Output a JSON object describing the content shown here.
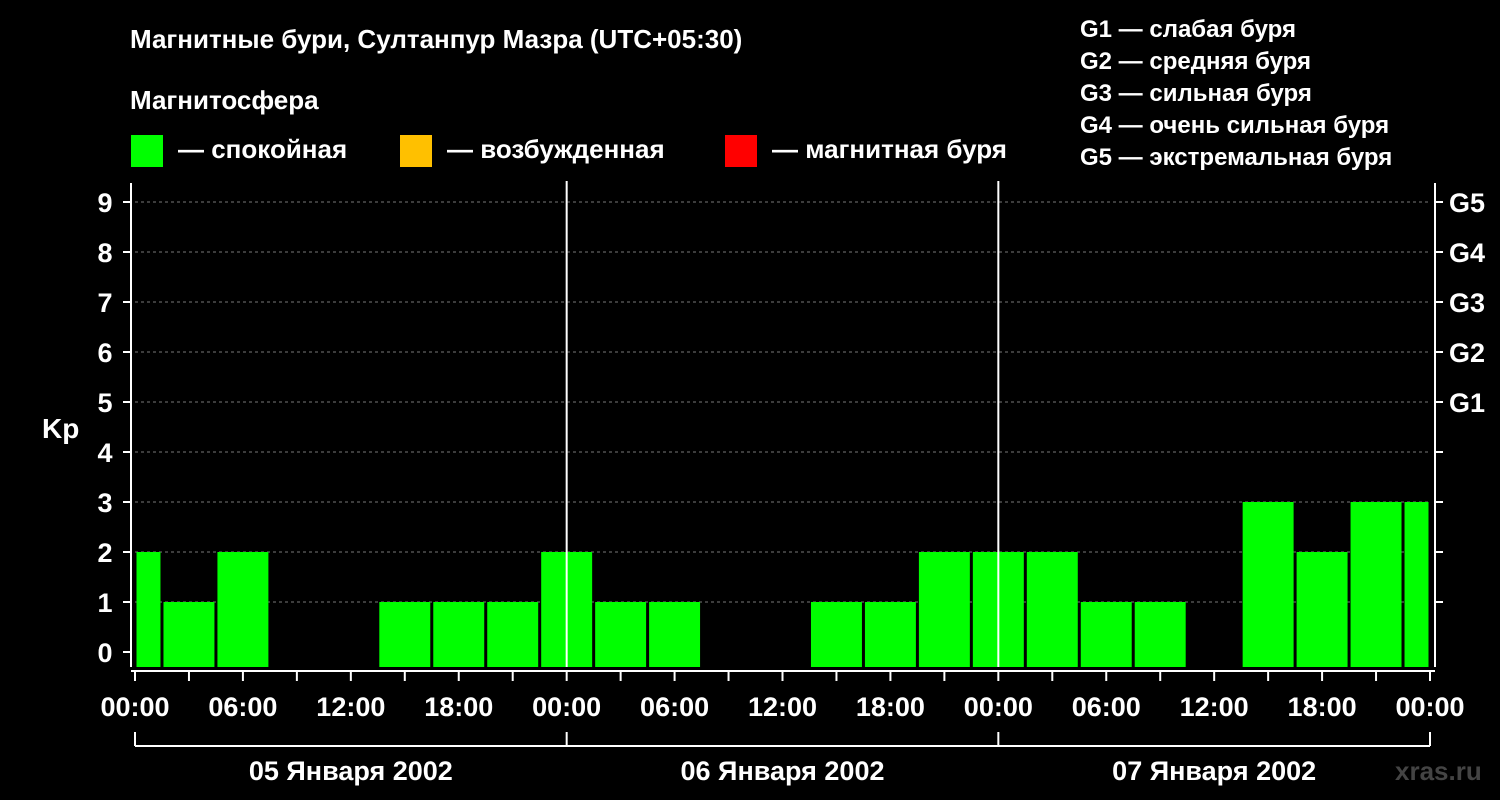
{
  "chart_data": {
    "type": "bar",
    "title": "Магнитные бури, Султанпур Мазра (UTC+05:30)",
    "legend": {
      "title": "Магнитосфера",
      "items": [
        {
          "label": "— спокойная",
          "color": "#00ff00"
        },
        {
          "label": "— возбужденная",
          "color": "#ffc000"
        },
        {
          "label": "— магнитная буря",
          "color": "#ff0000"
        }
      ],
      "storm_levels": [
        "G1 — слабая буря",
        "G2 — средняя буря",
        "G3 — сильная буря",
        "G4 — очень сильная буря",
        "G5 — экстремальная буря"
      ]
    },
    "ylabel": "Kp",
    "ylim": [
      0,
      9
    ],
    "y_ticks": [
      "0",
      "1",
      "2",
      "3",
      "4",
      "5",
      "6",
      "7",
      "8",
      "9"
    ],
    "right_ticks": [
      {
        "value": 5,
        "label": "G1"
      },
      {
        "value": 6,
        "label": "G2"
      },
      {
        "value": 7,
        "label": "G3"
      },
      {
        "value": 8,
        "label": "G4"
      },
      {
        "value": 9,
        "label": "G5"
      }
    ],
    "grid": true,
    "x_ticks": [
      "00:00",
      "06:00",
      "12:00",
      "18:00",
      "00:00",
      "06:00",
      "12:00",
      "18:00",
      "00:00",
      "06:00",
      "12:00",
      "18:00",
      "00:00"
    ],
    "days": [
      "05 Января 2002",
      "06 Января 2002",
      "07 Января 2002"
    ],
    "bars": [
      {
        "start_hour": 0,
        "end_hour": 1.5,
        "value": 2
      },
      {
        "start_hour": 1.5,
        "end_hour": 4.5,
        "value": 1
      },
      {
        "start_hour": 4.5,
        "end_hour": 7.5,
        "value": 2
      },
      {
        "start_hour": 7.5,
        "end_hour": 10.5,
        "value": 0
      },
      {
        "start_hour": 10.5,
        "end_hour": 13.5,
        "value": 0
      },
      {
        "start_hour": 13.5,
        "end_hour": 16.5,
        "value": 1
      },
      {
        "start_hour": 16.5,
        "end_hour": 19.5,
        "value": 1
      },
      {
        "start_hour": 19.5,
        "end_hour": 22.5,
        "value": 1
      },
      {
        "start_hour": 22.5,
        "end_hour": 25.5,
        "value": 2
      },
      {
        "start_hour": 25.5,
        "end_hour": 28.5,
        "value": 1
      },
      {
        "start_hour": 28.5,
        "end_hour": 31.5,
        "value": 1
      },
      {
        "start_hour": 31.5,
        "end_hour": 34.5,
        "value": 0
      },
      {
        "start_hour": 34.5,
        "end_hour": 37.5,
        "value": 0
      },
      {
        "start_hour": 37.5,
        "end_hour": 40.5,
        "value": 1
      },
      {
        "start_hour": 40.5,
        "end_hour": 43.5,
        "value": 1
      },
      {
        "start_hour": 43.5,
        "end_hour": 46.5,
        "value": 2
      },
      {
        "start_hour": 46.5,
        "end_hour": 49.5,
        "value": 2
      },
      {
        "start_hour": 49.5,
        "end_hour": 52.5,
        "value": 2
      },
      {
        "start_hour": 52.5,
        "end_hour": 55.5,
        "value": 1
      },
      {
        "start_hour": 55.5,
        "end_hour": 58.5,
        "value": 1
      },
      {
        "start_hour": 58.5,
        "end_hour": 61.5,
        "value": 0
      },
      {
        "start_hour": 61.5,
        "end_hour": 64.5,
        "value": 3
      },
      {
        "start_hour": 64.5,
        "end_hour": 67.5,
        "value": 2
      },
      {
        "start_hour": 67.5,
        "end_hour": 70.5,
        "value": 3
      },
      {
        "start_hour": 70.5,
        "end_hour": 72,
        "value": 3
      }
    ]
  },
  "watermark": "xras.ru"
}
